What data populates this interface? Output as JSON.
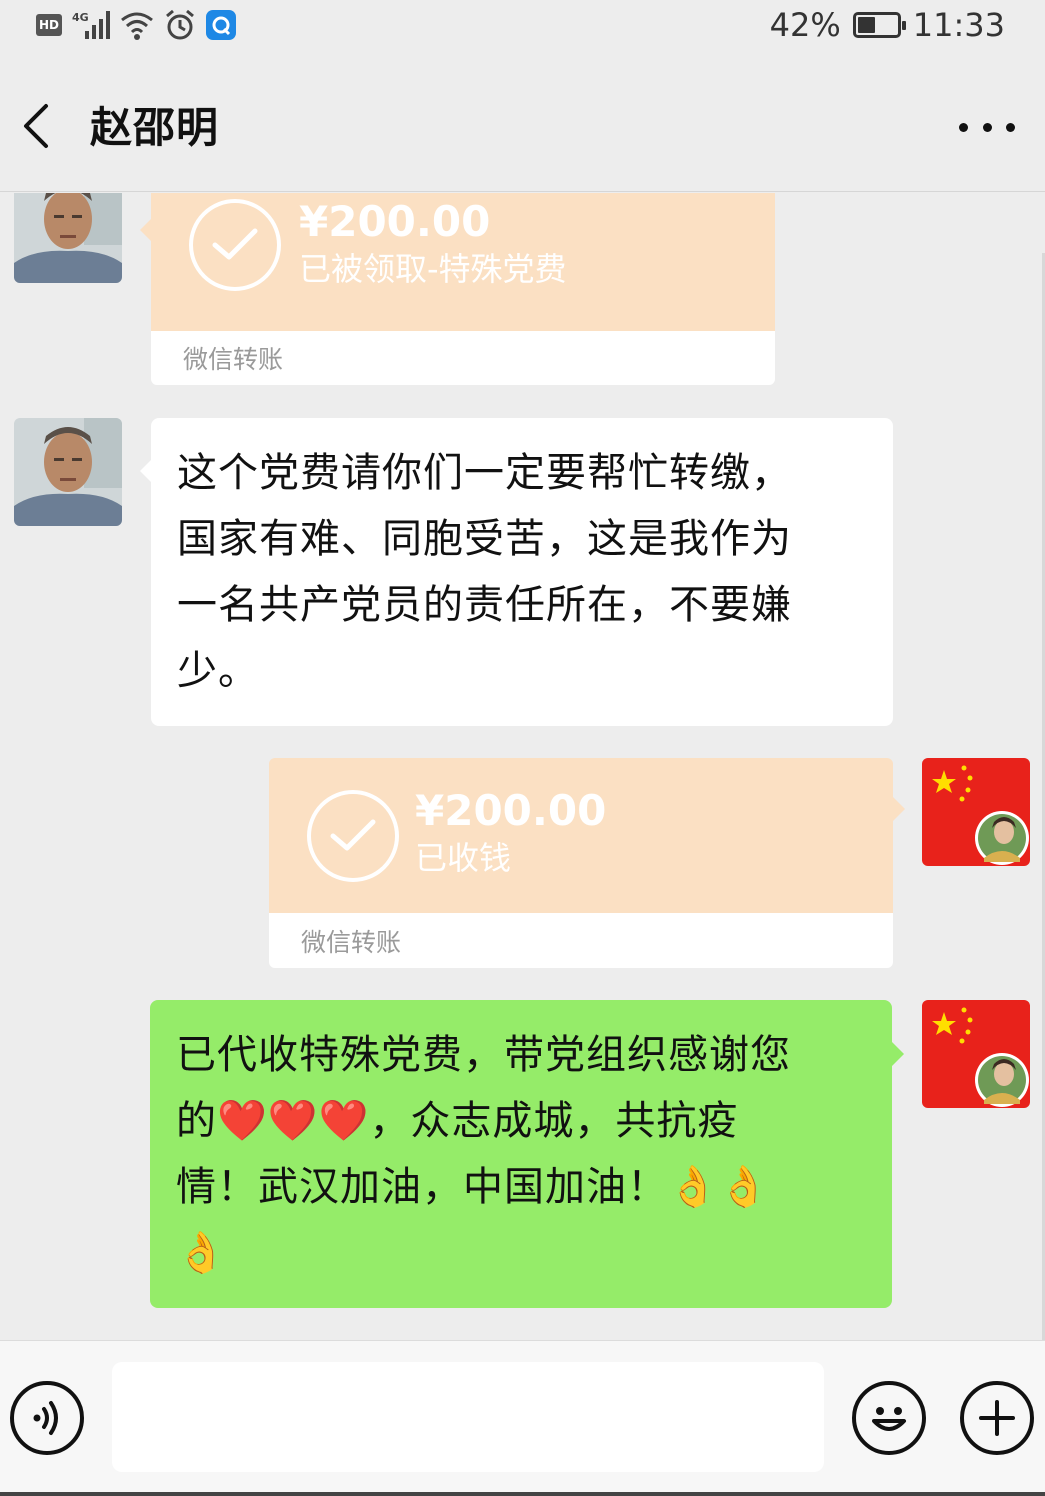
{
  "status_bar": {
    "hd": "HD",
    "network": "4G",
    "battery_percent_text": "42%",
    "battery_level": 0.42,
    "time": "11:33",
    "icons": [
      "hd-icon",
      "signal-icon",
      "wifi-icon",
      "alarm-icon",
      "browser-icon",
      "battery-icon"
    ]
  },
  "header": {
    "back_icon": "chevron-left-icon",
    "title": "赵邵明",
    "more_icon": "more-dots-icon"
  },
  "messages": [
    {
      "type": "transfer",
      "direction": "incoming",
      "amount": "¥200.00",
      "status": "已被领取-特殊党费",
      "footer": "微信转账",
      "icon": "check-circle-icon"
    },
    {
      "type": "text",
      "direction": "incoming",
      "lines": [
        "这个党费请你们一定要帮忙转缴，",
        "国家有难、同胞受苦，这是我作为",
        "一名共产党员的责任所在，不要嫌",
        "少。"
      ]
    },
    {
      "type": "transfer",
      "direction": "outgoing",
      "amount": "¥200.00",
      "status": "已收钱",
      "footer": "微信转账",
      "icon": "check-circle-icon"
    },
    {
      "type": "text",
      "direction": "outgoing",
      "lines": [
        "已代收特殊党费，带党组织感谢您",
        "的❤️❤️❤️，众志成城，共抗疫",
        "情！武汉加油，中国加油！👌👌",
        "👌"
      ]
    }
  ],
  "input_bar": {
    "voice_icon": "voice-icon",
    "input_value": "",
    "emoji_icon": "emoji-icon",
    "plus_icon": "plus-icon"
  },
  "colors": {
    "background": "#ededed",
    "transfer_orange": "#fbe0c3",
    "outgoing_green": "#95ec69",
    "incoming_white": "#ffffff"
  }
}
